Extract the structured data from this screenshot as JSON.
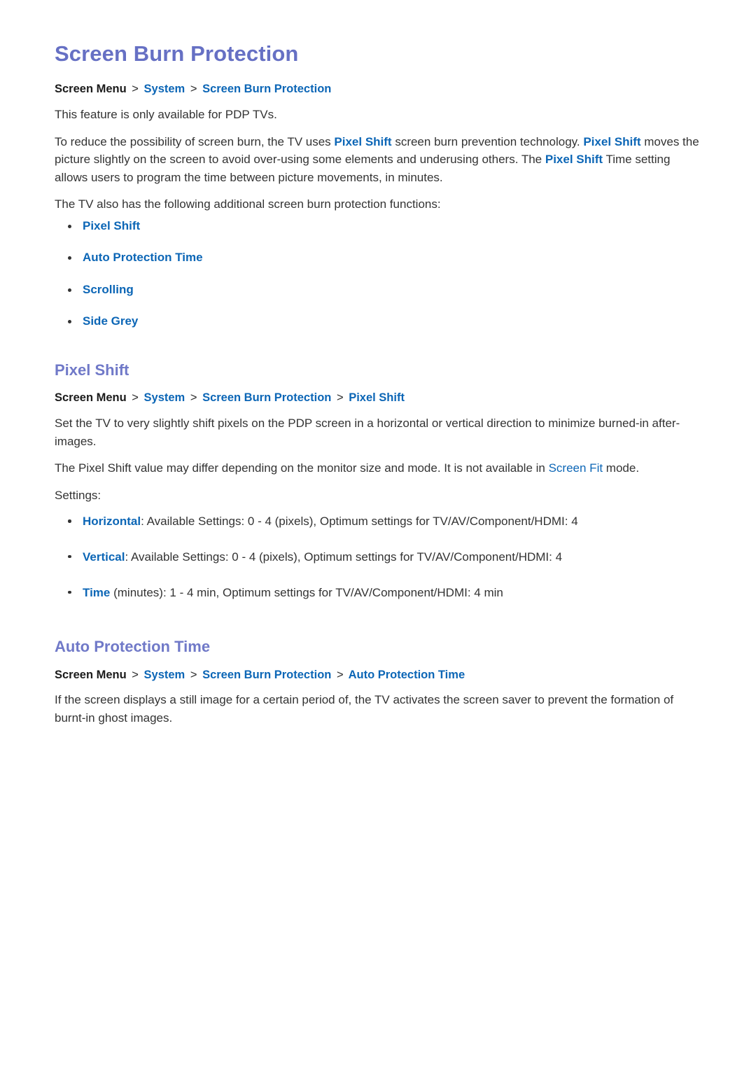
{
  "document": {
    "title": "Screen Burn Protection"
  },
  "sections": [
    {
      "id": "screen-burn-protection",
      "breadcrumb": {
        "root": "Screen Menu",
        "separator": ">",
        "links": [
          "System",
          "Screen Burn Protection"
        ]
      },
      "paragraphs": {
        "availability": "This feature is only available for PDP TVs.",
        "pixel_shift_intro_1": "To reduce the possibility of screen burn, the TV uses ",
        "pixel_shift_link_1": "Pixel Shift",
        "pixel_shift_intro_2": " screen burn prevention technology. ",
        "pixel_shift_link_2": "Pixel Shift",
        "pixel_shift_intro_3": " moves the picture slightly on the screen to avoid over-using some elements and underusing others. The ",
        "pixel_shift_link_3": "Pixel Shift",
        "pixel_shift_intro_4": " Time setting allows users to program the time between picture movements, in minutes.",
        "additional_functions": "The TV also has the following additional screen burn protection functions:"
      },
      "function_links": [
        "Pixel Shift",
        "Auto Protection Time",
        "Scrolling",
        "Side Grey"
      ]
    },
    {
      "id": "pixel-shift",
      "heading": "Pixel Shift",
      "breadcrumb": {
        "root": "Screen Menu",
        "separator": ">",
        "links": [
          "System",
          "Screen Burn Protection",
          "Pixel Shift"
        ]
      },
      "paragraphs": {
        "description": "Set the TV to very slightly shift pixels on the PDP screen in a horizontal or vertical direction to minimize burned-in after-images.",
        "availability_1": "The Pixel Shift value may differ depending on the monitor size and mode. It is not available in ",
        "availability_link": "Screen Fit",
        "availability_2": " mode.",
        "settings_label": "Settings:"
      },
      "settings": [
        {
          "name": "Horizontal",
          "detail": ": Available Settings: 0 - 4 (pixels), Optimum settings for TV/AV/Component/HDMI: 4"
        },
        {
          "name": "Vertical",
          "detail": ": Available Settings: 0 - 4 (pixels), Optimum settings for TV/AV/Component/HDMI: 4"
        },
        {
          "name": "Time",
          "detail": " (minutes): 1 - 4 min, Optimum settings for TV/AV/Component/HDMI: 4 min"
        }
      ]
    },
    {
      "id": "auto-protection-time",
      "heading": "Auto Protection Time",
      "breadcrumb": {
        "root": "Screen Menu",
        "separator": ">",
        "links": [
          "System",
          "Screen Burn Protection",
          "Auto Protection Time"
        ]
      },
      "paragraphs": {
        "description": "If the screen displays a still image for a certain period of, the TV activates the screen saver to prevent the formation of burnt-in ghost images."
      }
    }
  ],
  "colors": {
    "page_background": "#ffffff",
    "document_title": "#6670c4",
    "section_heading": "#7079c8",
    "link": "#0c66b6",
    "body_text": "#333333",
    "breadcrumb_root": "#1b1b1b"
  }
}
